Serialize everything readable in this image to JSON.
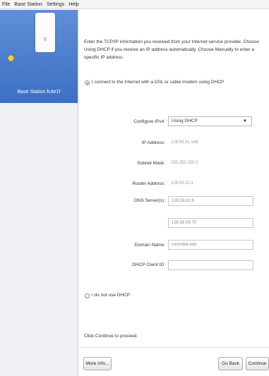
{
  "menu": {
    "items": [
      "File",
      "Base Station",
      "Settings",
      "Help"
    ]
  },
  "sidebar": {
    "device_label": "Base Station fc4e1f"
  },
  "main": {
    "intro_text": "Enter the TCP/IP information you received from your Internet service provider. Choose Using DHCP if you receive an IP address automatically. Choose Manually to enter a specific IP address.",
    "radio_dhcp_label": "I connect to the Internet with a DSL or cable modem using DHCP",
    "fields": {
      "configure_label": "Configure IPv4:",
      "configure_value": "Using DHCP",
      "ip_label": "IP Address:",
      "ip_value": "128.59.31.148",
      "subnet_label": "Subnet Mask:",
      "subnet_value": "255.255.255.0",
      "router_label": "Router Address:",
      "router_value": "128.59.31.1",
      "dns_label": "DNS Server(s):",
      "dns1_value": "128.59.61.9",
      "dns2_value": "128.59.59.70",
      "domain_label": "Domain Name:",
      "domain_value": "columbia.edu",
      "client_label": "DHCP Client ID:",
      "client_value": ""
    },
    "radio_nodhcp_label": "I do not use DHCP",
    "proceed_text": "Click Continue to proceed."
  },
  "buttons": {
    "more_info": "More Info...",
    "go_back": "Go Back",
    "continue": "Continue"
  }
}
